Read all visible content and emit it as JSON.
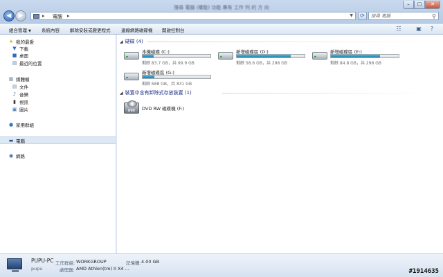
{
  "window": {
    "title": "搜尋 電腦 (權能) 功能 專有 工作 列 的 方 向",
    "controls": {
      "minimize": "–",
      "maximize": "□",
      "close": "✕"
    }
  },
  "address": {
    "separator": "▸",
    "location": "電腦",
    "search_placeholder": "搜尋 電腦"
  },
  "toolbar": {
    "items": [
      "組合管理",
      "系統內容",
      "解除安裝或變更程式",
      "連線網路磁碟機",
      "開啟控制台"
    ]
  },
  "nav": {
    "favorites": "我的最愛",
    "downloads": "下載",
    "desktop": "桌面",
    "recent": "最近的位置",
    "libraries": "媒體櫃",
    "documents": "文件",
    "music": "音樂",
    "videos": "視訊",
    "pictures": "圖片",
    "homegroup": "家用群組",
    "computer": "電腦",
    "network": "網路"
  },
  "groups": {
    "hard_disks": "硬碟 (4)",
    "removable": "裝置中含有卸除式存放裝置 (1)"
  },
  "drives": [
    {
      "name": "本機磁碟 (C:)",
      "free": "剩餘 83.7 GB，共 99.9 GB",
      "used_fraction": 0.16
    },
    {
      "name": "新增磁碟區 (D:)",
      "free": "剩餘 58.6 GB，共 298 GB",
      "used_fraction": 0.8
    },
    {
      "name": "新增磁碟區 (E:)",
      "free": "剩餘 84.8 GB，共 298 GB",
      "used_fraction": 0.72
    },
    {
      "name": "新增磁碟區 (G:)",
      "free": "剩餘 688 GB，共 831 GB",
      "used_fraction": 0.17
    }
  ],
  "dvd": {
    "name": "DVD RW 磁碟機 (F:)",
    "label": "DVD"
  },
  "details": {
    "pc_name": "PUPU-PC",
    "workgroup_label": "工作群組:",
    "workgroup": "WORKGROUP",
    "memory_label": "記憶體:",
    "memory": "4.00 GB",
    "user": "pupu",
    "processor_label": "處理器:",
    "processor": "AMD Athlon(tm) II X4 ..."
  },
  "watermark": "#1914635",
  "colors": {
    "bar_fill": "#1b84b0",
    "header_blue": "#1e3287"
  }
}
